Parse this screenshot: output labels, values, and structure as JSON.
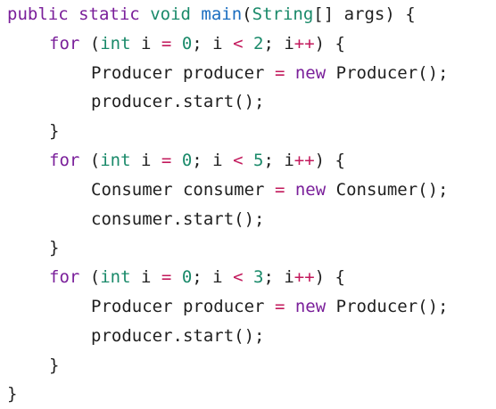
{
  "tokens": {
    "public": "public",
    "static": "static",
    "void": "void",
    "main": "main",
    "string_type": "String",
    "args_sig": "[] args) {",
    "for": "for",
    "int": "int",
    "var_i": "i",
    "eq": "=",
    "lt": "<",
    "inc": "++",
    "new": "new",
    "open_paren": "(",
    "close_brace": "}",
    "producer_class": "Producer",
    "producer_var": "producer",
    "consumer_class": "Consumer",
    "consumer_var": "consumer",
    "ctor_end": "();",
    "start_producer": "producer.start();",
    "start_consumer": "consumer.start();",
    "zero": "0",
    "loop_one_limit": "2",
    "loop_two_limit": "5",
    "loop_three_limit": "3"
  },
  "colors": {
    "keyword": "#7a1f9a",
    "type": "#1a8a6a",
    "function": "#1a6dc0",
    "operator": "#c2185b",
    "text": "#1f1f1f"
  }
}
